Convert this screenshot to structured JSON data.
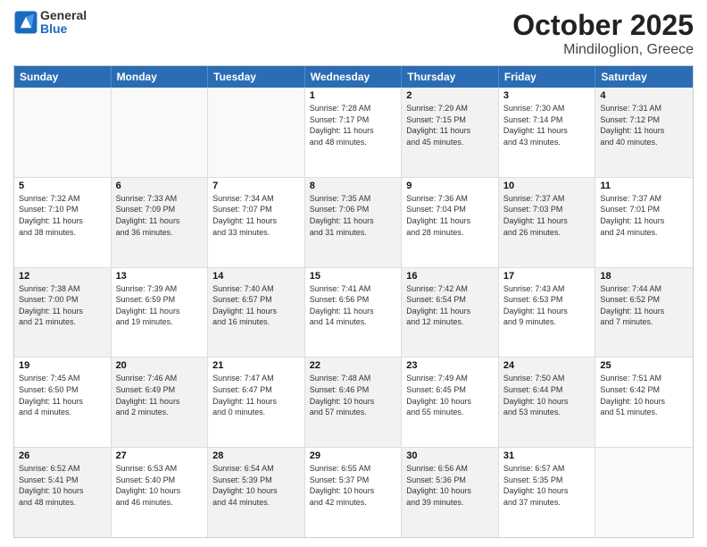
{
  "header": {
    "logo_general": "General",
    "logo_blue": "Blue",
    "title": "October 2025",
    "subtitle": "Mindiloglion, Greece"
  },
  "weekdays": [
    "Sunday",
    "Monday",
    "Tuesday",
    "Wednesday",
    "Thursday",
    "Friday",
    "Saturday"
  ],
  "weeks": [
    [
      {
        "day": "",
        "info": "",
        "empty": true
      },
      {
        "day": "",
        "info": "",
        "empty": true
      },
      {
        "day": "",
        "info": "",
        "empty": true
      },
      {
        "day": "1",
        "info": "Sunrise: 7:28 AM\nSunset: 7:17 PM\nDaylight: 11 hours\nand 48 minutes.",
        "shaded": false
      },
      {
        "day": "2",
        "info": "Sunrise: 7:29 AM\nSunset: 7:15 PM\nDaylight: 11 hours\nand 45 minutes.",
        "shaded": true
      },
      {
        "day": "3",
        "info": "Sunrise: 7:30 AM\nSunset: 7:14 PM\nDaylight: 11 hours\nand 43 minutes.",
        "shaded": false
      },
      {
        "day": "4",
        "info": "Sunrise: 7:31 AM\nSunset: 7:12 PM\nDaylight: 11 hours\nand 40 minutes.",
        "shaded": true
      }
    ],
    [
      {
        "day": "5",
        "info": "Sunrise: 7:32 AM\nSunset: 7:10 PM\nDaylight: 11 hours\nand 38 minutes.",
        "shaded": false
      },
      {
        "day": "6",
        "info": "Sunrise: 7:33 AM\nSunset: 7:09 PM\nDaylight: 11 hours\nand 36 minutes.",
        "shaded": true
      },
      {
        "day": "7",
        "info": "Sunrise: 7:34 AM\nSunset: 7:07 PM\nDaylight: 11 hours\nand 33 minutes.",
        "shaded": false
      },
      {
        "day": "8",
        "info": "Sunrise: 7:35 AM\nSunset: 7:06 PM\nDaylight: 11 hours\nand 31 minutes.",
        "shaded": true
      },
      {
        "day": "9",
        "info": "Sunrise: 7:36 AM\nSunset: 7:04 PM\nDaylight: 11 hours\nand 28 minutes.",
        "shaded": false
      },
      {
        "day": "10",
        "info": "Sunrise: 7:37 AM\nSunset: 7:03 PM\nDaylight: 11 hours\nand 26 minutes.",
        "shaded": true
      },
      {
        "day": "11",
        "info": "Sunrise: 7:37 AM\nSunset: 7:01 PM\nDaylight: 11 hours\nand 24 minutes.",
        "shaded": false
      }
    ],
    [
      {
        "day": "12",
        "info": "Sunrise: 7:38 AM\nSunset: 7:00 PM\nDaylight: 11 hours\nand 21 minutes.",
        "shaded": true
      },
      {
        "day": "13",
        "info": "Sunrise: 7:39 AM\nSunset: 6:59 PM\nDaylight: 11 hours\nand 19 minutes.",
        "shaded": false
      },
      {
        "day": "14",
        "info": "Sunrise: 7:40 AM\nSunset: 6:57 PM\nDaylight: 11 hours\nand 16 minutes.",
        "shaded": true
      },
      {
        "day": "15",
        "info": "Sunrise: 7:41 AM\nSunset: 6:56 PM\nDaylight: 11 hours\nand 14 minutes.",
        "shaded": false
      },
      {
        "day": "16",
        "info": "Sunrise: 7:42 AM\nSunset: 6:54 PM\nDaylight: 11 hours\nand 12 minutes.",
        "shaded": true
      },
      {
        "day": "17",
        "info": "Sunrise: 7:43 AM\nSunset: 6:53 PM\nDaylight: 11 hours\nand 9 minutes.",
        "shaded": false
      },
      {
        "day": "18",
        "info": "Sunrise: 7:44 AM\nSunset: 6:52 PM\nDaylight: 11 hours\nand 7 minutes.",
        "shaded": true
      }
    ],
    [
      {
        "day": "19",
        "info": "Sunrise: 7:45 AM\nSunset: 6:50 PM\nDaylight: 11 hours\nand 4 minutes.",
        "shaded": false
      },
      {
        "day": "20",
        "info": "Sunrise: 7:46 AM\nSunset: 6:49 PM\nDaylight: 11 hours\nand 2 minutes.",
        "shaded": true
      },
      {
        "day": "21",
        "info": "Sunrise: 7:47 AM\nSunset: 6:47 PM\nDaylight: 11 hours\nand 0 minutes.",
        "shaded": false
      },
      {
        "day": "22",
        "info": "Sunrise: 7:48 AM\nSunset: 6:46 PM\nDaylight: 10 hours\nand 57 minutes.",
        "shaded": true
      },
      {
        "day": "23",
        "info": "Sunrise: 7:49 AM\nSunset: 6:45 PM\nDaylight: 10 hours\nand 55 minutes.",
        "shaded": false
      },
      {
        "day": "24",
        "info": "Sunrise: 7:50 AM\nSunset: 6:44 PM\nDaylight: 10 hours\nand 53 minutes.",
        "shaded": true
      },
      {
        "day": "25",
        "info": "Sunrise: 7:51 AM\nSunset: 6:42 PM\nDaylight: 10 hours\nand 51 minutes.",
        "shaded": false
      }
    ],
    [
      {
        "day": "26",
        "info": "Sunrise: 6:52 AM\nSunset: 5:41 PM\nDaylight: 10 hours\nand 48 minutes.",
        "shaded": true
      },
      {
        "day": "27",
        "info": "Sunrise: 6:53 AM\nSunset: 5:40 PM\nDaylight: 10 hours\nand 46 minutes.",
        "shaded": false
      },
      {
        "day": "28",
        "info": "Sunrise: 6:54 AM\nSunset: 5:39 PM\nDaylight: 10 hours\nand 44 minutes.",
        "shaded": true
      },
      {
        "day": "29",
        "info": "Sunrise: 6:55 AM\nSunset: 5:37 PM\nDaylight: 10 hours\nand 42 minutes.",
        "shaded": false
      },
      {
        "day": "30",
        "info": "Sunrise: 6:56 AM\nSunset: 5:36 PM\nDaylight: 10 hours\nand 39 minutes.",
        "shaded": true
      },
      {
        "day": "31",
        "info": "Sunrise: 6:57 AM\nSunset: 5:35 PM\nDaylight: 10 hours\nand 37 minutes.",
        "shaded": false
      },
      {
        "day": "",
        "info": "",
        "empty": true
      }
    ]
  ]
}
